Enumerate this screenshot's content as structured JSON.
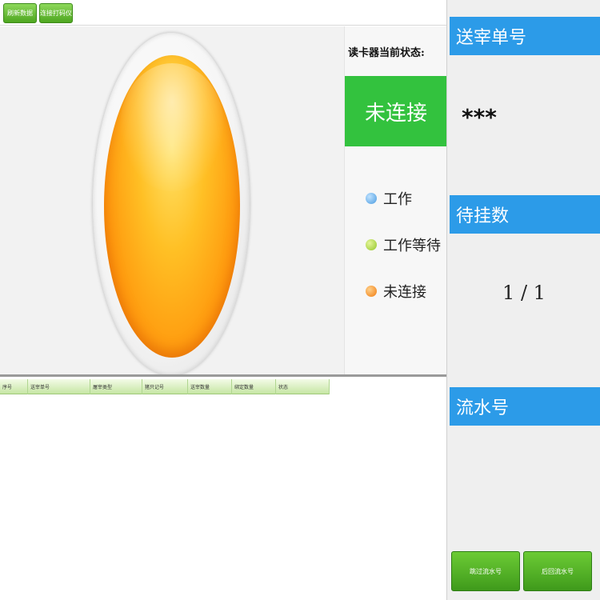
{
  "toolbar": {
    "refresh_label": "刷新数据",
    "connect_label": "连接打码仪"
  },
  "status_panel": {
    "reader_status_label": "读卡器当前状态:",
    "current_status": "未连接",
    "status_color": "#33c23e",
    "legend": [
      {
        "label": "工作",
        "color": "#4a9be0"
      },
      {
        "label": "工作等待",
        "color": "#93c628"
      },
      {
        "label": "未连接",
        "color": "#f07c10"
      }
    ]
  },
  "table": {
    "columns": [
      "序号",
      "送宰单号",
      "屠宰类型",
      "猪只记号",
      "送宰数量",
      "绑定数量",
      "状态"
    ],
    "rows": []
  },
  "right_panel": {
    "order_no_label": "送宰单号",
    "order_no_value": "***",
    "pending_label": "待挂数",
    "pending_value": "1 / 1",
    "serial_label": "流水号",
    "skip_button": "跳过流水号",
    "back_button": "后回流水号",
    "header_color": "#2c9be8"
  }
}
